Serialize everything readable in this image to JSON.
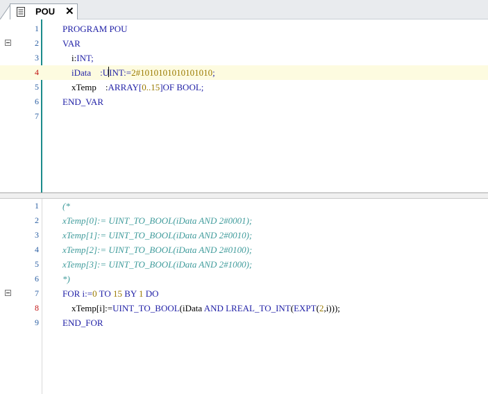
{
  "tab": {
    "label": "POU",
    "close": "✕",
    "icon": "document-icon"
  },
  "colors": {
    "keyword": "#1f1fa6",
    "number": "#9a7a00",
    "comment": "#3f9b9b",
    "current_line": "#fdfbe0",
    "line_number": "#2b5fa3",
    "modified_line_number": "#c01010"
  },
  "declaration": {
    "lines": [
      {
        "n": "1",
        "t1": "PROGRAM POU"
      },
      {
        "n": "2",
        "t1": "VAR"
      },
      {
        "n": "3",
        "t1": "    i:",
        "t2": "INT;"
      },
      {
        "n": "4",
        "t1": "    iData    :U",
        "t2": "INT:=",
        "t3": "2#1010101010101010",
        "t4": ";"
      },
      {
        "n": "5",
        "t1": "    xTemp    :",
        "t2": "ARRAY[",
        "t3": "0..15",
        "t4": "]OF BOOL;"
      },
      {
        "n": "6",
        "t1": "END_VAR"
      },
      {
        "n": "7",
        "t1": ""
      }
    ]
  },
  "implementation": {
    "lines": [
      {
        "n": "1",
        "t1": "(*"
      },
      {
        "n": "2",
        "t1": "xTemp[0]:= UINT_TO_BOOL(iData AND 2#0001);"
      },
      {
        "n": "3",
        "t1": "xTemp[1]:= UINT_TO_BOOL(iData AND 2#0010);"
      },
      {
        "n": "4",
        "t1": "xTemp[2]:= UINT_TO_BOOL(iData AND 2#0100);"
      },
      {
        "n": "5",
        "t1": "xTemp[3]:= UINT_TO_BOOL(iData AND 2#1000);"
      },
      {
        "n": "6",
        "t1": "*)"
      },
      {
        "n": "7",
        "t1": "FOR i:=",
        "t2": "0",
        "t3": " TO ",
        "t4": "15",
        "t5": " BY ",
        "t6": "1",
        "t7": " DO"
      },
      {
        "n": "8",
        "t1": "    xTemp[i]:=",
        "t2": "UINT_TO_BOOL",
        "t3": "(iData ",
        "t4": "AND",
        "t5": " ",
        "t6": "LREAL_TO_INT",
        "t7": "(",
        "t8": "EXPT",
        "t9": "(",
        "t10": "2",
        "t11": ",i)));"
      },
      {
        "n": "9",
        "t1": "END_FOR"
      }
    ]
  }
}
